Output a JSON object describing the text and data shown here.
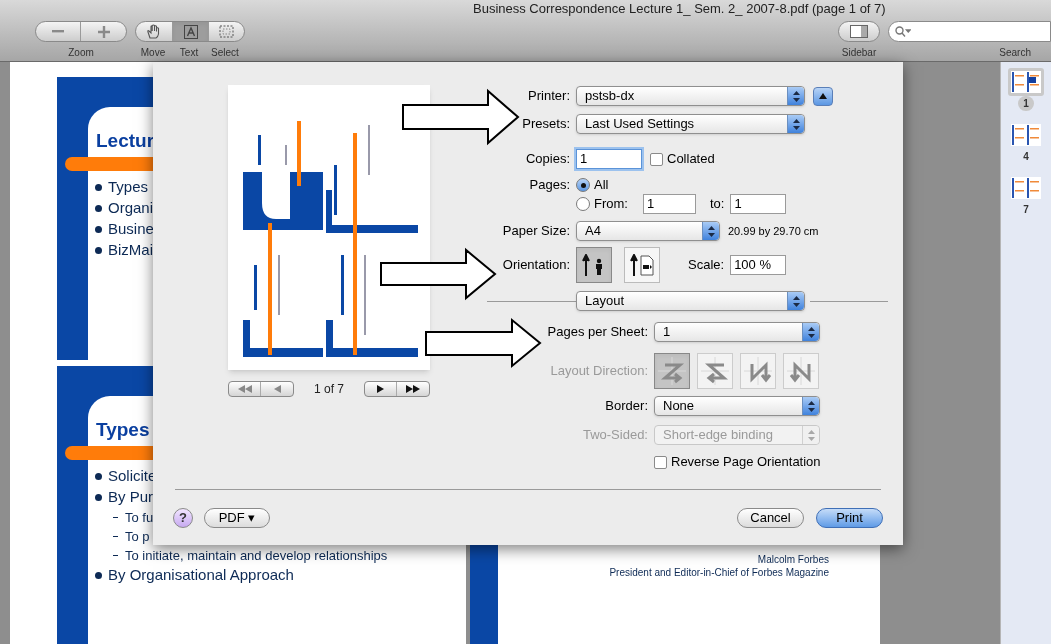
{
  "window": {
    "title": "Business Correspondence Lecture 1_ Sem. 2_ 2007-8.pdf (page 1 of 7)"
  },
  "toolbar": {
    "zoom": {
      "label": "Zoom"
    },
    "tools": [
      {
        "kind": "move",
        "label": "Move",
        "selected": false
      },
      {
        "kind": "text",
        "label": "Text",
        "selected": true
      },
      {
        "kind": "select",
        "label": "Select",
        "selected": false
      }
    ],
    "sidebar": {
      "label": "Sidebar"
    },
    "search": {
      "label": "Search"
    }
  },
  "document": {
    "slides": [
      {
        "title": "Lectur",
        "bullets": [
          {
            "text": "Types"
          },
          {
            "text": "Organi"
          },
          {
            "text": "Busine"
          },
          {
            "text": "BizMai"
          }
        ]
      },
      {
        "title": "Types",
        "bullets": [
          {
            "text": "Solicite"
          },
          {
            "text": "By Pur",
            "children": [
              {
                "text": "To fu"
              },
              {
                "text": "To p"
              },
              {
                "text": "To initiate, maintain and develop relationships"
              }
            ]
          },
          {
            "text": "By Organisational Approach"
          }
        ]
      }
    ],
    "quote_attribution": [
      "Malcolm Forbes",
      "President and Editor-in-Chief of Forbes Magazine"
    ]
  },
  "thumbnails": [
    {
      "page": "1",
      "selected": true
    },
    {
      "page": "4",
      "selected": false
    },
    {
      "page": "7",
      "selected": false
    }
  ],
  "print_dialog": {
    "preview": {
      "page_indicator": "1 of 7"
    },
    "printer": {
      "label": "Printer:",
      "value": "pstsb-dx"
    },
    "presets": {
      "label": "Presets:",
      "value": "Last Used Settings"
    },
    "copies": {
      "label": "Copies:",
      "value": "1"
    },
    "collated": {
      "label": "Collated",
      "checked": false
    },
    "pages": {
      "label": "Pages:",
      "options": [
        {
          "label": "All",
          "selected": true
        },
        {
          "label": "From:",
          "selected": false
        }
      ],
      "from": "1",
      "to_label": "to:",
      "to": "1"
    },
    "paper_size": {
      "label": "Paper Size:",
      "value": "A4",
      "dimensions": "20.99 by 29.70 cm"
    },
    "orientation": {
      "label": "Orientation:",
      "options": [
        {
          "kind": "portrait",
          "selected": true
        },
        {
          "kind": "landscape",
          "selected": false
        }
      ]
    },
    "scale": {
      "label": "Scale:",
      "value": "100 %"
    },
    "section": "Layout",
    "pages_per_sheet": {
      "label": "Pages per Sheet:",
      "value": "1"
    },
    "layout_direction": {
      "label": "Layout Direction:",
      "disabled": true,
      "options": [
        {
          "kind": "z",
          "selected": true
        },
        {
          "kind": "s",
          "selected": false
        },
        {
          "kind": "reverse-n",
          "selected": false
        },
        {
          "kind": "n",
          "selected": false
        }
      ]
    },
    "border": {
      "label": "Border:",
      "value": "None"
    },
    "two_sided": {
      "label": "Two-Sided:",
      "value": "Short-edge binding",
      "disabled": true
    },
    "reverse_orientation": {
      "label": "Reverse Page Orientation",
      "checked": false
    },
    "help": {
      "label": "?"
    },
    "pdf": {
      "label": "PDF ▾"
    },
    "buttons": [
      {
        "label": "Cancel",
        "default": false
      },
      {
        "label": "Print",
        "default": true
      }
    ]
  }
}
